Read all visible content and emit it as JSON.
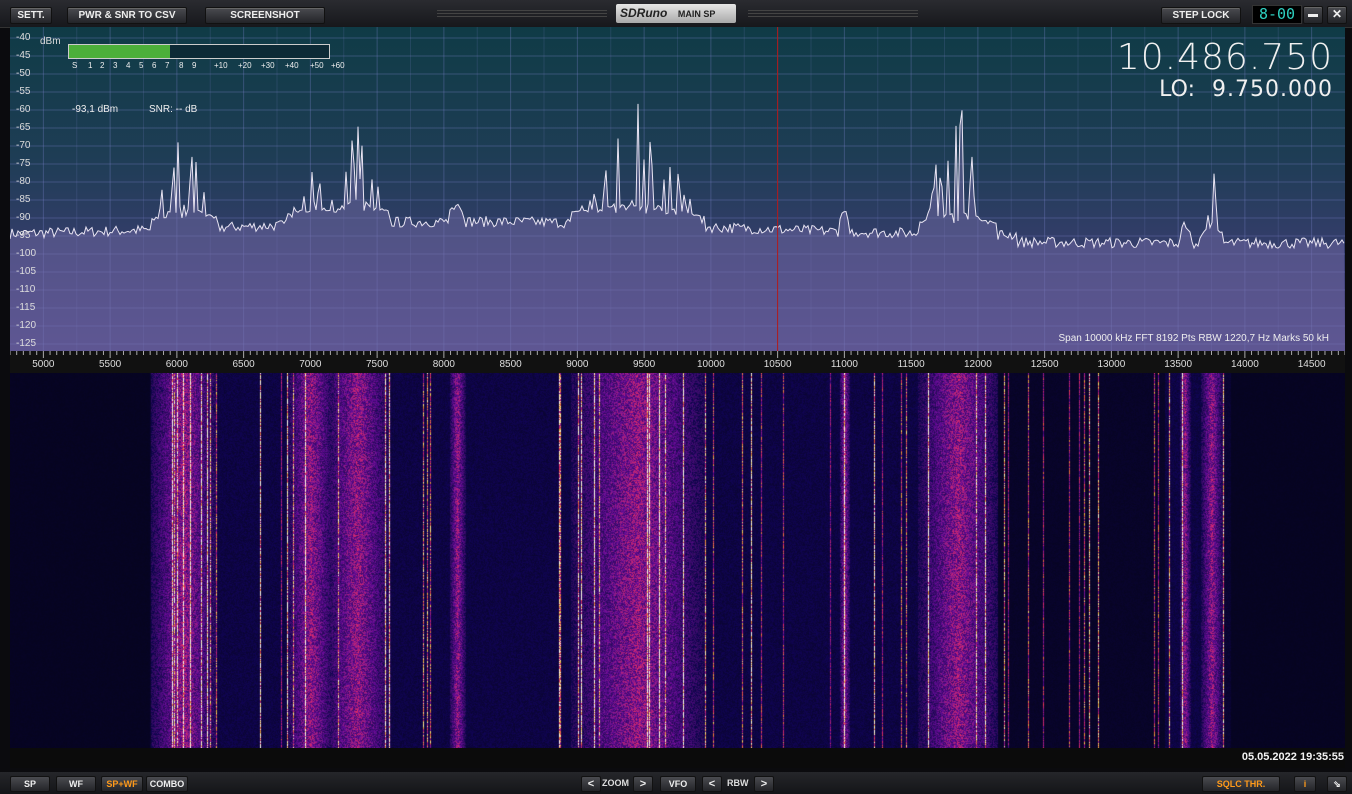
{
  "toolbar": {
    "settings": "SETT.",
    "csv": "PWR & SNR TO CSV",
    "screenshot": "SCREENSHOT",
    "brand_logo": "SDRuno",
    "brand_window": "MAIN SP",
    "step_lock": "STEP LOCK",
    "clock_display": "8-00",
    "minimize": "▬",
    "close": "✕"
  },
  "spectrum": {
    "unit": "dBm",
    "db_labels": [
      "-40",
      "-45",
      "-50",
      "-55",
      "-60",
      "-65",
      "-70",
      "-75",
      "-80",
      "-85",
      "-90",
      "-95",
      "-100",
      "-105",
      "-110",
      "-115",
      "-120",
      "-125"
    ],
    "smeter_ticks": [
      "S",
      "1",
      "2",
      "3",
      "4",
      "5",
      "6",
      "7",
      "8",
      "9",
      "+10",
      "+20",
      "+30",
      "+40",
      "+50",
      "+60"
    ],
    "smeter_level": 0.39,
    "power_readout": "-93,1 dBm",
    "snr_readout": "SNR: -- dB",
    "frequency": "10.486.750",
    "lo_label": "LO:",
    "lo_value": "9.750.000",
    "info": "Span 10000 kHz   FFT 8192 Pts   RBW 1220,7 Hz   Marks 50 kH"
  },
  "axis": {
    "labels": [
      "5000",
      "5500",
      "6000",
      "6500",
      "7000",
      "7500",
      "8000",
      "8500",
      "9000",
      "9500",
      "10000",
      "10500",
      "11000",
      "11500",
      "12000",
      "12500",
      "13000",
      "13500",
      "14000",
      "14500"
    ],
    "min": 4750,
    "max": 14750,
    "center": 10500
  },
  "waterfall": {
    "timestamp": "05.05.2022 19:35:55"
  },
  "bottombar": {
    "sp": "SP",
    "wf": "WF",
    "spwf": "SP+WF",
    "combo": "COMBO",
    "prev": "<",
    "zoom": "ZOOM",
    "next": ">",
    "vfo": "VFO",
    "rbw_prev": "<",
    "rbw": "RBW",
    "rbw_next": ">",
    "sqlc": "SQLC THR.",
    "info": "i",
    "resize": "⇘"
  },
  "colors": {
    "accent_orange": "#ff9a1a",
    "meter_green": "#4caf3a",
    "clock_cyan": "#2ed0c0",
    "center_line": "#b01818"
  }
}
